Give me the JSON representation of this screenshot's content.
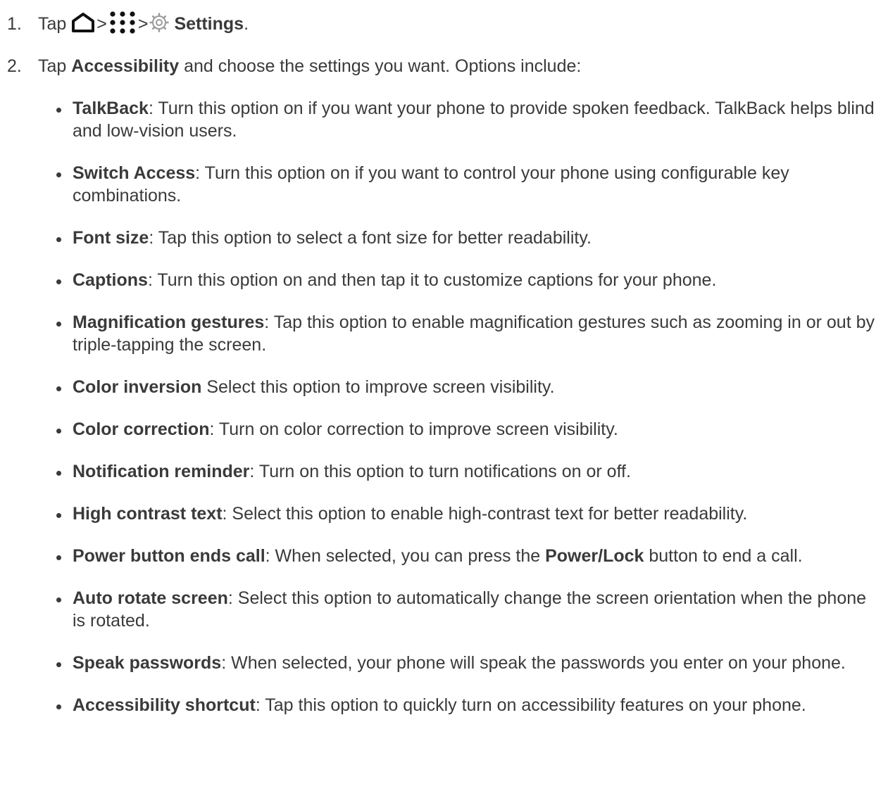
{
  "step1": {
    "number": "1.",
    "tap": "Tap",
    "separator": ">",
    "settings_label": "Settings",
    "period": "."
  },
  "step2": {
    "number": "2.",
    "tap": "Tap",
    "accessibility_label": "Accessibility",
    "rest": " and choose the settings you want. Options include:"
  },
  "options": [
    {
      "term": "TalkBack",
      "desc": ": Turn this option on if you want your phone to provide spoken feedback. TalkBack helps blind and low-vision users."
    },
    {
      "term": "Switch Access",
      "desc": ": Turn this option on if you want to control your phone using configurable key combinations."
    },
    {
      "term": "Font size",
      "desc": ": Tap this option to select a font size for better readability."
    },
    {
      "term": "Captions",
      "desc": ": Turn this option on and then tap it to customize captions for your phone."
    },
    {
      "term": "Magnification gestures",
      "desc": ": Tap this option to enable magnification gestures such as zooming in or out by triple-tapping the screen."
    },
    {
      "term": "Color inversion",
      "desc": " Select this option to improve screen visibility."
    },
    {
      "term": "Color correction",
      "desc": ": Turn on color correction to improve screen visibility."
    },
    {
      "term": "Notification reminder",
      "desc": ": Turn on this option to turn notifications on or off."
    },
    {
      "term": "High contrast text",
      "desc": ": Select this option to enable high-contrast text for better readability."
    },
    {
      "term": "Power button ends call",
      "desc": ": When selected, you can press the ",
      "inline_bold": "Power/Lock",
      "desc_after": " button to end a call."
    },
    {
      "term": "Auto rotate screen",
      "desc": ": Select this option to automatically change the screen orientation when the phone is rotated."
    },
    {
      "term": "Speak passwords",
      "desc": ": When selected, your phone will speak the passwords you enter on your phone."
    },
    {
      "term": "Accessibility shortcut",
      "desc": ": Tap this option to quickly turn on accessibility features on your phone."
    }
  ],
  "icons": {
    "home": "home-icon",
    "apps": "apps-icon",
    "settings": "gear-icon"
  },
  "colors": {
    "text": "#3a3a3a",
    "icon_gray": "#9a9a9a"
  }
}
